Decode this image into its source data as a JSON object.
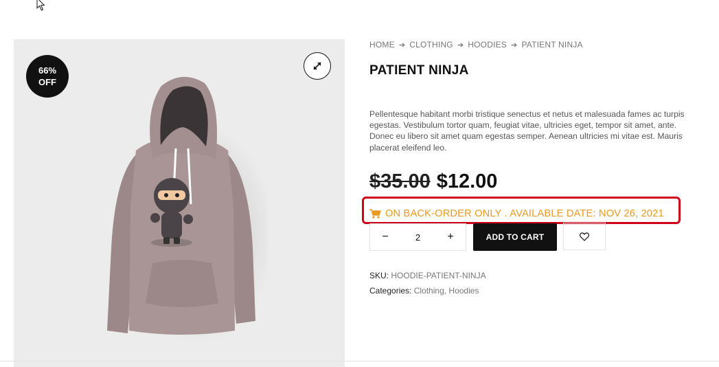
{
  "product": {
    "badge": {
      "percent": "66%",
      "text": "OFF"
    },
    "breadcrumb": [
      "HOME",
      "CLOTHING",
      "HOODIES",
      "PATIENT NINJA"
    ],
    "title": "PATIENT NINJA",
    "description": "Pellentesque habitant morbi tristique senectus et netus et malesuada fames ac turpis egestas. Vestibulum tortor quam, feugiat vitae, ultricies eget, tempor sit amet, ante. Donec eu libero sit amet quam egestas semper. Aenean ultricies mi vitae est. Mauris placerat eleifend leo.",
    "old_price": "$35.00",
    "new_price": "$12.00",
    "stock_notice": "ON BACK-ORDER ONLY . AVAILABLE DATE: NOV 26, 2021",
    "quantity": "2",
    "add_to_cart": "ADD TO CART",
    "sku_label": "SKU:",
    "sku_value": "HOODIE-PATIENT-NINJA",
    "categories_label": "Categories:",
    "categories": [
      "Clothing",
      "Hoodies"
    ],
    "category_separator": ", "
  },
  "controls": {
    "minus": "−",
    "plus": "+"
  },
  "icons": {
    "zoom": "expand-arrows-icon",
    "cart": "cart-icon",
    "wishlist": "heart-icon",
    "breadcrumb_sep": "arrow-right-icon"
  },
  "colors": {
    "accent_orange": "#e89a23",
    "highlight_red": "#d0021b",
    "button_black": "#111111"
  }
}
